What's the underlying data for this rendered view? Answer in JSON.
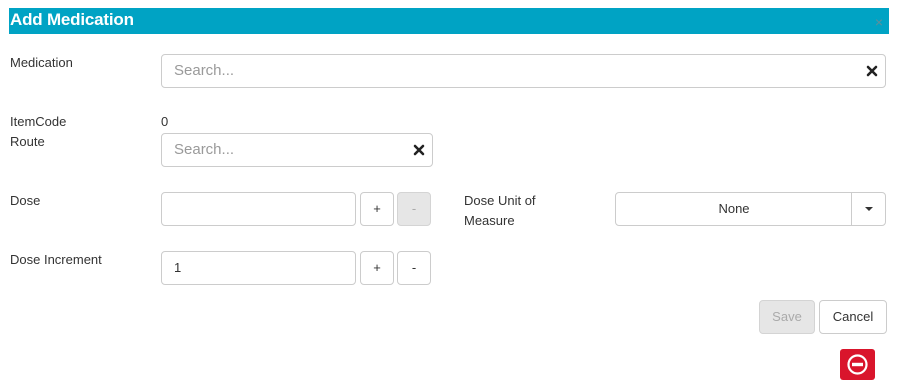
{
  "dialog": {
    "title": "Add Medication",
    "close_label": "×"
  },
  "medication": {
    "label": "Medication",
    "placeholder": "Search..."
  },
  "item_code": {
    "label": "ItemCode",
    "value": "0"
  },
  "route": {
    "label": "Route",
    "placeholder": "Search..."
  },
  "dose": {
    "label": "Dose",
    "value": "",
    "increment_label": "+",
    "decrement_label": "-"
  },
  "dose_unit": {
    "label": "Dose Unit of Measure",
    "selected": "None"
  },
  "dose_increment": {
    "label": "Dose Increment",
    "value": "1",
    "increment_label": "+",
    "decrement_label": "-"
  },
  "footer": {
    "save_label": "Save",
    "cancel_label": "Cancel"
  },
  "colors": {
    "header": "#00a3c4",
    "remove": "#d9152c",
    "disabled": "#e6e6e6",
    "border": "#cccccc"
  }
}
